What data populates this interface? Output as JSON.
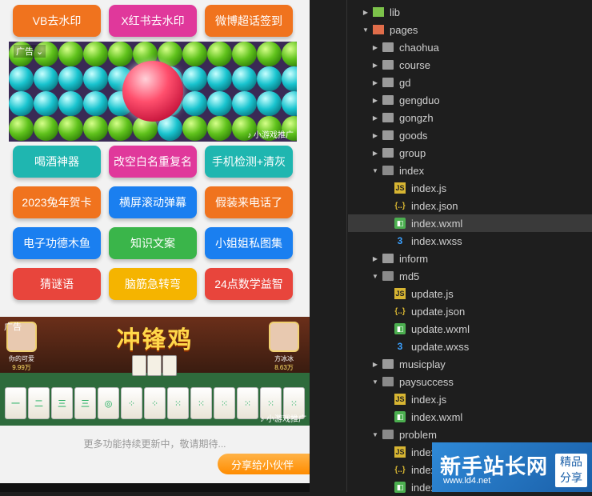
{
  "phone": {
    "row1": [
      "VB去水印",
      "X红书去水印",
      "微博超话签到"
    ],
    "row2": [
      "喝酒神器",
      "改空白名重复名",
      "手机检测+清灰"
    ],
    "row3": [
      "2023兔年贺卡",
      "横屏滚动弹幕",
      "假装来电话了"
    ],
    "row4": [
      "电子功德木鱼",
      "知识文案",
      "小姐姐私图集"
    ],
    "row5": [
      "猜谜语",
      "脑筋急转弯",
      "24点数学益智"
    ],
    "colors": {
      "row1": [
        "#f0731e",
        "#e0389b",
        "#f0731e"
      ],
      "row2": [
        "#1fb6b0",
        "#e0389b",
        "#1fb6b0"
      ],
      "row3": [
        "#f0731e",
        "#1a7ff0",
        "#f0731e"
      ],
      "row4": [
        "#1a7ff0",
        "#3ab54a",
        "#1a7ff0"
      ],
      "row5": [
        "#e8453c",
        "#f5b400",
        "#e8453c"
      ]
    },
    "ad1": {
      "tag": "广告",
      "source": "小游戏推广"
    },
    "ad2": {
      "tag": "广告",
      "title": "冲锋鸡",
      "left_player": {
        "name": "你的可爱",
        "amount": "9.99万"
      },
      "right_player": {
        "name": "方冰冰",
        "amount": "8.63万"
      },
      "tiles": [
        "一",
        "二",
        "三",
        "三",
        "◎",
        "⁘",
        "⁘",
        "⁙",
        "⁙",
        "⁙",
        "⁙",
        "⁙",
        "⁙"
      ],
      "source": "小游戏推广"
    },
    "more_text": "更多功能持续更新中，敬请期待...",
    "share_label": "分享给小伙伴"
  },
  "tree": {
    "rows": [
      {
        "label": "lib",
        "type": "lib",
        "depth": 0,
        "open": false
      },
      {
        "label": "pages",
        "type": "pages",
        "depth": 0,
        "open": true
      },
      {
        "label": "chaohua",
        "type": "folder",
        "depth": 1,
        "open": false
      },
      {
        "label": "course",
        "type": "folder",
        "depth": 1,
        "open": false
      },
      {
        "label": "gd",
        "type": "folder",
        "depth": 1,
        "open": false
      },
      {
        "label": "gengduo",
        "type": "folder",
        "depth": 1,
        "open": false
      },
      {
        "label": "gongzh",
        "type": "folder",
        "depth": 1,
        "open": false
      },
      {
        "label": "goods",
        "type": "folder",
        "depth": 1,
        "open": false
      },
      {
        "label": "group",
        "type": "folder",
        "depth": 1,
        "open": false
      },
      {
        "label": "index",
        "type": "folder",
        "depth": 1,
        "open": true
      },
      {
        "label": "index.js",
        "type": "js",
        "depth": 2
      },
      {
        "label": "index.json",
        "type": "json",
        "depth": 2
      },
      {
        "label": "index.wxml",
        "type": "wxml",
        "depth": 2,
        "selected": true
      },
      {
        "label": "index.wxss",
        "type": "wxss",
        "depth": 2
      },
      {
        "label": "inform",
        "type": "folder",
        "depth": 1,
        "open": false
      },
      {
        "label": "md5",
        "type": "folder",
        "depth": 1,
        "open": true
      },
      {
        "label": "update.js",
        "type": "js",
        "depth": 2
      },
      {
        "label": "update.json",
        "type": "json",
        "depth": 2
      },
      {
        "label": "update.wxml",
        "type": "wxml",
        "depth": 2
      },
      {
        "label": "update.wxss",
        "type": "wxss",
        "depth": 2
      },
      {
        "label": "musicplay",
        "type": "folder",
        "depth": 1,
        "open": false
      },
      {
        "label": "paysuccess",
        "type": "folder",
        "depth": 1,
        "open": true
      },
      {
        "label": "index.js",
        "type": "js",
        "depth": 2
      },
      {
        "label": "index.wxml",
        "type": "wxml",
        "depth": 2
      },
      {
        "label": "problem",
        "type": "folder",
        "depth": 1,
        "open": true
      },
      {
        "label": "index.js",
        "type": "js",
        "depth": 2
      },
      {
        "label": "index.json",
        "type": "json",
        "depth": 2
      },
      {
        "label": "index.wxml",
        "type": "wxml",
        "depth": 2
      }
    ]
  },
  "watermark": {
    "big": "新手站长网",
    "url": "www.ld4.net",
    "badge1": "精品",
    "badge2": "分享"
  }
}
